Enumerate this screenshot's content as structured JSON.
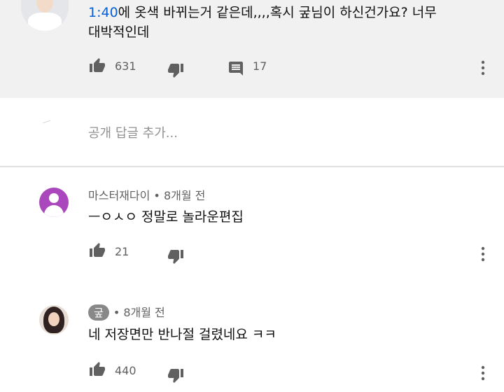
{
  "top_comment": {
    "timestamp": "1:40",
    "text_line1": "에 옷색 바뀌는거 같은데,,,,혹시 궆님이 하신건가요? 너무",
    "text_line2": "대박적인데",
    "likes": "631",
    "replies": "17"
  },
  "reply_box": {
    "placeholder": "공개 답글 추가..."
  },
  "replies": [
    {
      "author": "마스터재다이",
      "time": "• 8개월 전",
      "text": "ㅡㅇㅅㅇ 정말로 놀라운편집",
      "likes": "21",
      "avatar_color": "#ab47bc"
    },
    {
      "author": "궆",
      "time": "• 8개월 전",
      "text": "네 저장면만 반나절 걸렸네요 ㅋㅋ",
      "likes": "440"
    }
  ],
  "icons": {
    "like": "thumb-up-icon",
    "dislike": "thumb-down-icon",
    "reply": "comment-icon",
    "menu": "more-vert-icon"
  },
  "colors": {
    "link": "#065fd4",
    "top_bg": "#f1f1f1",
    "muted": "#606060"
  }
}
